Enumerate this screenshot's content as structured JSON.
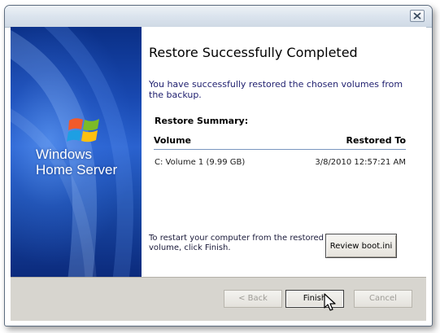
{
  "dialog": {
    "banner": {
      "brand_line1": "Windows",
      "brand_line2": "Home Server"
    },
    "heading": "Restore Successfully Completed",
    "intro": "You have successfully restored the chosen volumes from the backup.",
    "summary": {
      "label": "Restore Summary:",
      "columns": [
        "Volume",
        "Restored To"
      ],
      "rows": [
        [
          "C: Volume 1 (9.99 GB)",
          "3/8/2010 12:57:21 AM"
        ]
      ]
    },
    "restart_text": "To restart your computer from the restored volume, click Finish.",
    "review_button": "Review boot.ini",
    "buttons": {
      "back": "< Back",
      "finish": "Finish",
      "cancel": "Cancel"
    }
  },
  "icons": {
    "close": "close-icon",
    "logo": "windows-flag-icon",
    "cursor": "mouse-pointer-icon"
  },
  "colors": {
    "banner_blue": "#1848b0",
    "footer_gray": "#d7d5cf",
    "disabled_text": "#9e9c96"
  }
}
